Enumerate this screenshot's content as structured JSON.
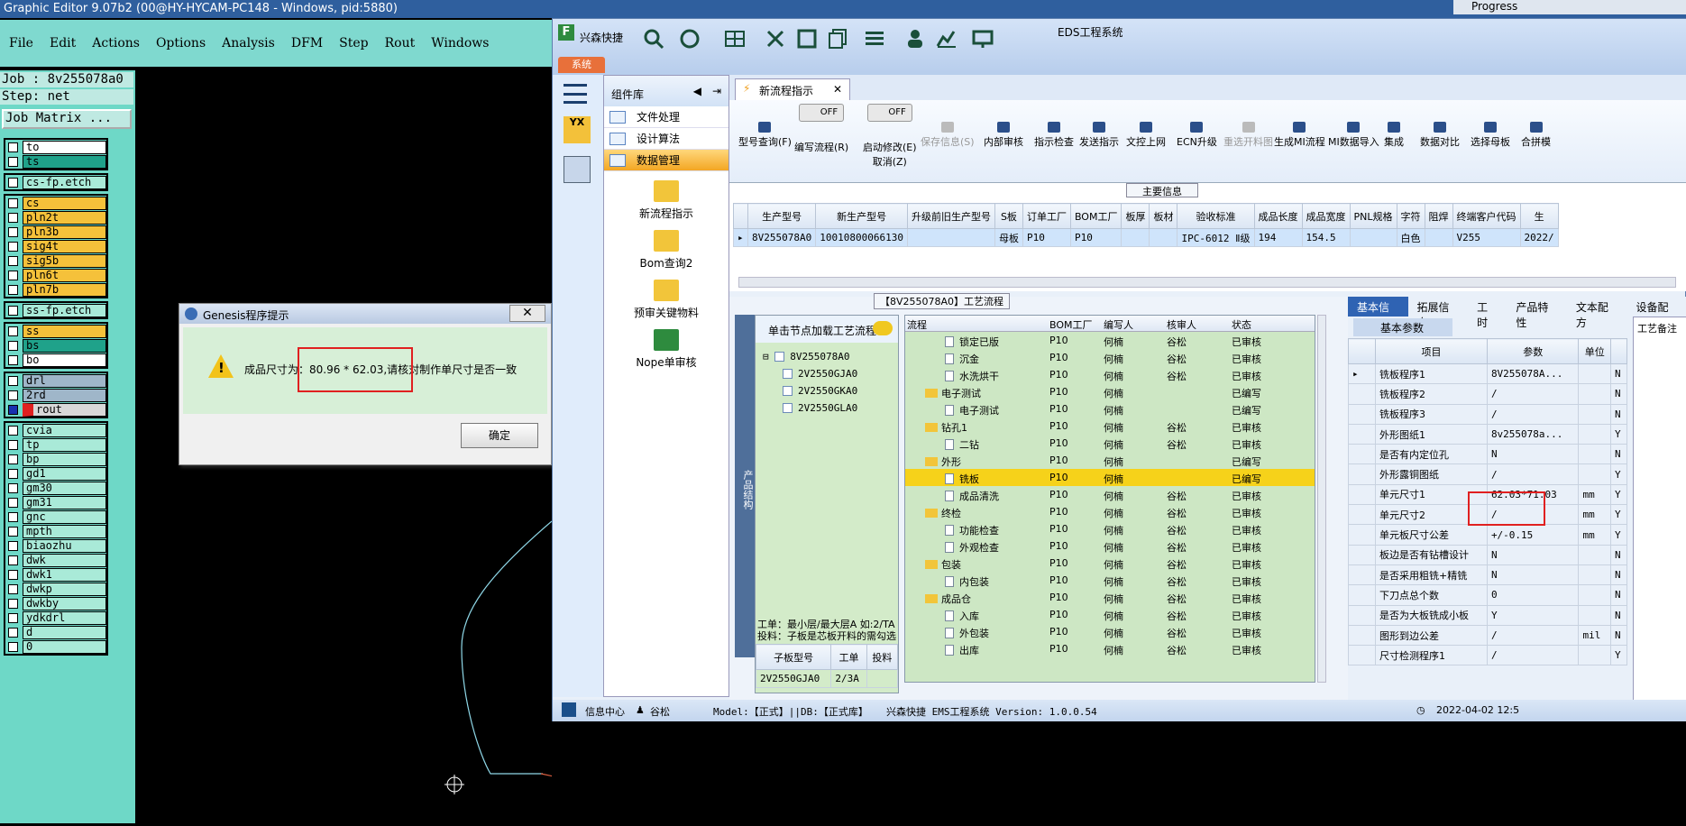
{
  "genesis": {
    "title": "Graphic Editor 9.07b2 (00@HY-HYCAM-PC148 - Windows, pid:5880)",
    "menu": [
      "File",
      "Edit",
      "Actions",
      "Options",
      "Analysis",
      "DFM",
      "Step",
      "Rout",
      "Windows"
    ],
    "job": "Job : 8v255078a0",
    "step": "Step: net",
    "job_matrix": "Job Matrix ...",
    "layer_groups": [
      [
        {
          "name": "to",
          "color": "#ffffff",
          "arrow": true
        },
        {
          "name": "ts",
          "color": "#1fa28a",
          "arrow": false
        }
      ],
      [
        {
          "name": "cs-fp.etch",
          "color": "#a9ead8",
          "arrow": false
        }
      ],
      [
        {
          "name": "cs",
          "color": "#f5c13a",
          "arrow": false
        },
        {
          "name": "pln2t",
          "color": "#f5c13a",
          "arrow": true
        },
        {
          "name": "pln3b",
          "color": "#f5c13a",
          "arrow": true
        },
        {
          "name": "sig4t",
          "color": "#f5c13a",
          "arrow": false
        },
        {
          "name": "sig5b",
          "color": "#f5c13a",
          "arrow": false
        },
        {
          "name": "pln6t",
          "color": "#f5c13a",
          "arrow": true
        },
        {
          "name": "pln7b",
          "color": "#f5c13a",
          "arrow": true
        }
      ],
      [
        {
          "name": "ss-fp.etch",
          "color": "#a9ead8",
          "arrow": false
        }
      ],
      [
        {
          "name": "ss",
          "color": "#f5c13a",
          "arrow": false
        },
        {
          "name": "bs",
          "color": "#1fa28a",
          "arrow": false
        },
        {
          "name": "bo",
          "color": "#ffffff",
          "arrow": true
        }
      ],
      [
        {
          "name": "drl",
          "color": "#9fb6c9",
          "arrow": false
        },
        {
          "name": "2rd",
          "color": "#9fb6c9",
          "arrow": false
        },
        {
          "name": "rout",
          "color": "#d8d8d8",
          "arrow": true
        }
      ],
      [
        {
          "name": "cvia",
          "color": "#a9ead8",
          "arrow": false
        },
        {
          "name": "tp",
          "color": "#a9ead8",
          "arrow": true
        },
        {
          "name": "bp",
          "color": "#a9ead8",
          "arrow": false
        },
        {
          "name": "gd1",
          "color": "#a9ead8",
          "arrow": true
        },
        {
          "name": "gm30",
          "color": "#a9ead8",
          "arrow": true
        },
        {
          "name": "gm31",
          "color": "#a9ead8",
          "arrow": true
        },
        {
          "name": "gnc",
          "color": "#a9ead8",
          "arrow": true
        },
        {
          "name": "mpth",
          "color": "#a9ead8",
          "arrow": false
        },
        {
          "name": "biaozhu",
          "color": "#a9ead8",
          "arrow": false
        },
        {
          "name": "dwk",
          "color": "#a9ead8",
          "arrow": false
        },
        {
          "name": "dwk1",
          "color": "#a9ead8",
          "arrow": false
        },
        {
          "name": "dwkp",
          "color": "#a9ead8",
          "arrow": false
        },
        {
          "name": "dwkby",
          "color": "#a9ead8",
          "arrow": false
        },
        {
          "name": "ydkdrl",
          "color": "#a9ead8",
          "arrow": false
        },
        {
          "name": "d",
          "color": "#a9ead8",
          "arrow": false
        },
        {
          "name": "0",
          "color": "#a9ead8",
          "arrow": false
        }
      ]
    ]
  },
  "dialog": {
    "title": "Genesis程序提示",
    "close": "✕",
    "message": "成品尺寸为：80.96 * 62.03,请核对制作单尺寸是否一致",
    "ok": "确定"
  },
  "eds": {
    "title": "EDS工程系统",
    "brand": "兴森快捷",
    "sys_tab": "系统",
    "component_lib": "组件库",
    "component_items": [
      "文件处理",
      "设计算法",
      "数据管理"
    ],
    "big_items": [
      "新流程指示",
      "Bom查询2",
      "预审关键物料",
      "Nope单审核"
    ],
    "tab": "新流程指示",
    "ribbon": [
      {
        "label": "型号查询(F)",
        "disabled": false
      },
      {
        "label": "编写流程(R)",
        "disabled": false,
        "toggle": "OFF"
      },
      {
        "label": "启动修改(E)\n取消(Z)",
        "disabled": false,
        "toggle": "OFF"
      },
      {
        "label": "保存信息(S)",
        "disabled": true
      },
      {
        "label": "内部审核",
        "disabled": false
      },
      {
        "label": "指示检查",
        "disabled": false
      },
      {
        "label": "发送指示",
        "disabled": false
      },
      {
        "label": "文控上网",
        "disabled": false
      },
      {
        "label": "ECN升级",
        "disabled": false
      },
      {
        "label": "重选开料图",
        "disabled": true
      },
      {
        "label": "生成MI流程",
        "disabled": false
      },
      {
        "label": "MI数据导入",
        "disabled": false
      },
      {
        "label": "集成",
        "disabled": false
      },
      {
        "label": "数据对比",
        "disabled": false
      },
      {
        "label": "选择母板",
        "disabled": false
      },
      {
        "label": "合拼模",
        "disabled": false
      }
    ],
    "main_info_title": "主要信息",
    "main_cols": [
      "生产型号",
      "新生产型号",
      "升级前旧生产型号",
      "S板",
      "订单工厂",
      "BOM工厂",
      "板厚",
      "板材",
      "验收标准",
      "成品长度",
      "成品宽度",
      "PNL规格",
      "字符",
      "阻焊",
      "终端客户代码",
      "生"
    ],
    "main_row": [
      "8V255078A0",
      "10010800066130",
      "",
      "母板",
      "P10",
      "P10",
      "",
      "",
      "IPC-6012 Ⅱ级",
      "194",
      "154.5",
      "",
      "白色",
      "",
      "V255",
      "2022/"
    ],
    "proc_title": "【8V255078A0】工艺流程",
    "struct_label": "产品结构",
    "left_head": "单击节点加载工艺流程",
    "tree_root": "8V255078A0",
    "tree_children": [
      "2V2550GJA0",
      "2V2550GKA0",
      "2V2550GLA0"
    ],
    "note1": "工单：最小层/最大层A 如:2/TA",
    "note2": "投料：子板是芯板开料的需勾选",
    "sub_cols": [
      "子板型号",
      "工单",
      "投料"
    ],
    "sub_row": [
      "2V2550GJA0",
      "2/3A",
      ""
    ],
    "flow_cols": [
      "流程",
      "BOM工厂",
      "编写人",
      "核审人",
      "状态"
    ],
    "flow_rows": [
      {
        "name": "锁定已版",
        "lvl": 2,
        "folder": false,
        "bom": "P10",
        "writer": "何楠",
        "checker": "谷松",
        "status": "已审核"
      },
      {
        "name": "沉金",
        "lvl": 2,
        "folder": false,
        "bom": "P10",
        "writer": "何楠",
        "checker": "谷松",
        "status": "已审核"
      },
      {
        "name": "水洗烘干",
        "lvl": 2,
        "folder": false,
        "bom": "P10",
        "writer": "何楠",
        "checker": "谷松",
        "status": "已审核"
      },
      {
        "name": "电子测试",
        "lvl": 1,
        "folder": true,
        "bom": "P10",
        "writer": "何楠",
        "checker": "",
        "status": "已编写"
      },
      {
        "name": "电子测试",
        "lvl": 2,
        "folder": false,
        "bom": "P10",
        "writer": "何楠",
        "checker": "",
        "status": "已编写"
      },
      {
        "name": "钻孔1",
        "lvl": 1,
        "folder": true,
        "bom": "P10",
        "writer": "何楠",
        "checker": "谷松",
        "status": "已审核"
      },
      {
        "name": "二钻",
        "lvl": 2,
        "folder": false,
        "bom": "P10",
        "writer": "何楠",
        "checker": "谷松",
        "status": "已审核"
      },
      {
        "name": "外形",
        "lvl": 1,
        "folder": true,
        "bom": "P10",
        "writer": "何楠",
        "checker": "",
        "status": "已编写"
      },
      {
        "name": "铣板",
        "lvl": 2,
        "folder": false,
        "bom": "P10",
        "writer": "何楠",
        "checker": "",
        "status": "已编写",
        "hl": true
      },
      {
        "name": "成品清洗",
        "lvl": 2,
        "folder": false,
        "bom": "P10",
        "writer": "何楠",
        "checker": "谷松",
        "status": "已审核"
      },
      {
        "name": "终检",
        "lvl": 1,
        "folder": true,
        "bom": "P10",
        "writer": "何楠",
        "checker": "谷松",
        "status": "已审核"
      },
      {
        "name": "功能检查",
        "lvl": 2,
        "folder": false,
        "bom": "P10",
        "writer": "何楠",
        "checker": "谷松",
        "status": "已审核"
      },
      {
        "name": "外观检查",
        "lvl": 2,
        "folder": false,
        "bom": "P10",
        "writer": "何楠",
        "checker": "谷松",
        "status": "已审核"
      },
      {
        "name": "包装",
        "lvl": 1,
        "folder": true,
        "bom": "P10",
        "writer": "何楠",
        "checker": "谷松",
        "status": "已审核"
      },
      {
        "name": "内包装",
        "lvl": 2,
        "folder": false,
        "bom": "P10",
        "writer": "何楠",
        "checker": "谷松",
        "status": "已审核"
      },
      {
        "name": "成品仓",
        "lvl": 1,
        "folder": true,
        "bom": "P10",
        "writer": "何楠",
        "checker": "谷松",
        "status": "已审核"
      },
      {
        "name": "入库",
        "lvl": 2,
        "folder": false,
        "bom": "P10",
        "writer": "何楠",
        "checker": "谷松",
        "status": "已审核"
      },
      {
        "name": "外包装",
        "lvl": 2,
        "folder": false,
        "bom": "P10",
        "writer": "何楠",
        "checker": "谷松",
        "status": "已审核"
      },
      {
        "name": "出库",
        "lvl": 2,
        "folder": false,
        "bom": "P10",
        "writer": "何楠",
        "checker": "谷松",
        "status": "已审核"
      }
    ],
    "right_tabs": [
      "基本信息",
      "拓展信息",
      "工时",
      "产品特性",
      "文本配方",
      "设备配方"
    ],
    "basic_params": "基本参数",
    "param_cols": [
      "项目",
      "参数",
      "单位"
    ],
    "params": [
      [
        "铣板程序1",
        "8V255078A...",
        "",
        "N"
      ],
      [
        "铣板程序2",
        "/",
        "",
        "N"
      ],
      [
        "铣板程序3",
        "/",
        "",
        "N"
      ],
      [
        "外形图纸1",
        "8v255078a...",
        "",
        "Y"
      ],
      [
        "是否有内定位孔",
        "N",
        "",
        "N"
      ],
      [
        "外形露铜图纸",
        "/",
        "",
        "Y"
      ],
      [
        "单元尺寸1",
        "62.03*71.03",
        "mm",
        "Y"
      ],
      [
        "单元尺寸2",
        "/",
        "mm",
        "Y"
      ],
      [
        "单元板尺寸公差",
        "+/-0.15",
        "mm",
        "Y"
      ],
      [
        "板边是否有钻槽设计",
        "N",
        "",
        "N"
      ],
      [
        "是否采用粗铣+精铣",
        "N",
        "",
        "N"
      ],
      [
        "下刀点总个数",
        "0",
        "",
        "N"
      ],
      [
        "是否为大板铣成小板",
        "Y",
        "",
        "N"
      ],
      [
        "图形到边公差",
        "/",
        "mil",
        "N"
      ],
      [
        "尺寸检测程序1",
        "/",
        "",
        "Y"
      ]
    ],
    "right_side_label": "工艺备注",
    "status": {
      "info_center": "信息中心",
      "user": "谷松",
      "model": "Model:【正式】||DB:【正式库】",
      "version": "兴森快捷 EMS工程系统 Version: 1.0.0.54",
      "time": "2022-04-02 12:5"
    }
  },
  "progress": {
    "title": "Progress"
  }
}
